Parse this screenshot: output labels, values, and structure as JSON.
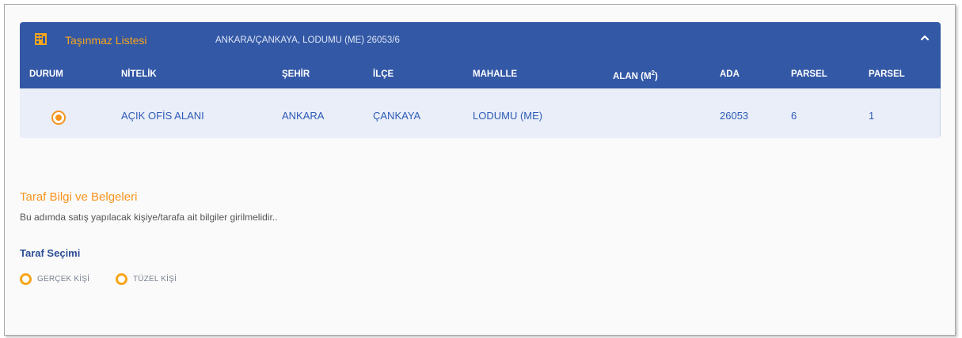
{
  "property_list": {
    "title": "Taşınmaz Listesi",
    "location": "ANKARA/ÇANKAYA, LODUMU (ME) 26053/6",
    "columns": {
      "durum": "DURUM",
      "nitelik": "NİTELİK",
      "sehir": "ŞEHİR",
      "ilce": "İLÇE",
      "mahalle": "MAHALLE",
      "alan": "ALAN (M",
      "alan_sup": "2",
      "alan_end": ")",
      "ada": "ADA",
      "parsel1": "PARSEL",
      "parsel2": "PARSEL"
    },
    "rows": [
      {
        "selected": true,
        "nitelik": "AÇIK OFİS ALANI",
        "sehir": "ANKARA",
        "ilce": "ÇANKAYA",
        "mahalle": "LODUMU (ME)",
        "alan": "",
        "ada": "26053",
        "parsel1": "6",
        "parsel2": "1"
      }
    ]
  },
  "party_section": {
    "title": "Taraf Bilgi ve Belgeleri",
    "description": "Bu adımda satış yapılacak kişiye/tarafa ait bilgiler girilmelidir..",
    "selection_label": "Taraf Seçimi",
    "options": [
      "GERÇEK KİŞİ",
      "TÜZEL KİŞİ"
    ]
  },
  "colors": {
    "header_bg": "#3358a6",
    "accent_orange": "#f7941d",
    "link_blue": "#2f5bb7"
  },
  "icons": {
    "title_icon": "building-icon",
    "collapse_icon": "chevron-up-icon"
  }
}
